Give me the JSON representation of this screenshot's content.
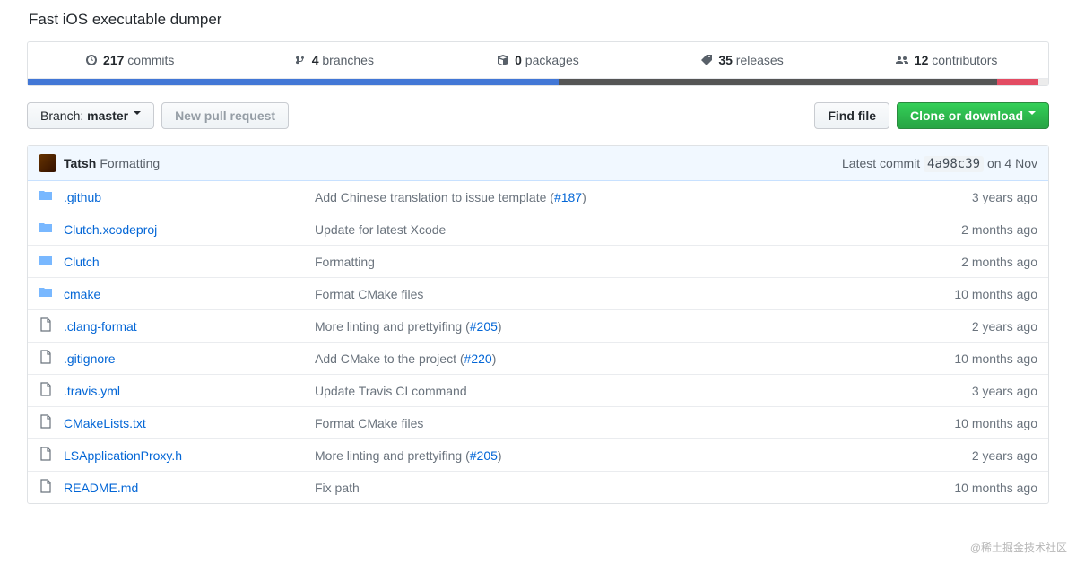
{
  "about": "Fast iOS executable dumper",
  "stats": {
    "commits": {
      "count": "217",
      "label": "commits"
    },
    "branches": {
      "count": "4",
      "label": "branches"
    },
    "packages": {
      "count": "0",
      "label": "packages"
    },
    "releases": {
      "count": "35",
      "label": "releases"
    },
    "contributors": {
      "count": "12",
      "label": "contributors"
    }
  },
  "languages": [
    {
      "color": "#4277d6",
      "pct": 52
    },
    {
      "color": "#555555",
      "pct": 43
    },
    {
      "color": "#e34c63",
      "pct": 4
    },
    {
      "color": "#ececec",
      "pct": 1
    }
  ],
  "toolbar": {
    "branch_prefix": "Branch: ",
    "branch_name": "master",
    "new_pr": "New pull request",
    "find_file": "Find file",
    "clone": "Clone or download"
  },
  "tease": {
    "author": "Tatsh",
    "msg": "Formatting",
    "latest_commit_prefix": "Latest commit ",
    "sha": "4a98c39",
    "date": " on 4 Nov"
  },
  "files": [
    {
      "type": "dir",
      "name": ".github",
      "msg": "Add Chinese translation to issue template (",
      "issue": "#187",
      "msg2": ")",
      "age": "3 years ago"
    },
    {
      "type": "dir",
      "name": "Clutch.xcodeproj",
      "msg": "Update for latest Xcode",
      "issue": "",
      "msg2": "",
      "age": "2 months ago"
    },
    {
      "type": "dir",
      "name": "Clutch",
      "msg": "Formatting",
      "issue": "",
      "msg2": "",
      "age": "2 months ago"
    },
    {
      "type": "dir",
      "name": "cmake",
      "msg": "Format CMake files",
      "issue": "",
      "msg2": "",
      "age": "10 months ago"
    },
    {
      "type": "file",
      "name": ".clang-format",
      "msg": "More linting and prettyifing (",
      "issue": "#205",
      "msg2": ")",
      "age": "2 years ago"
    },
    {
      "type": "file",
      "name": ".gitignore",
      "msg": "Add CMake to the project (",
      "issue": "#220",
      "msg2": ")",
      "age": "10 months ago"
    },
    {
      "type": "file",
      "name": ".travis.yml",
      "msg": "Update Travis CI command",
      "issue": "",
      "msg2": "",
      "age": "3 years ago"
    },
    {
      "type": "file",
      "name": "CMakeLists.txt",
      "msg": "Format CMake files",
      "issue": "",
      "msg2": "",
      "age": "10 months ago"
    },
    {
      "type": "file",
      "name": "LSApplicationProxy.h",
      "msg": "More linting and prettyifing (",
      "issue": "#205",
      "msg2": ")",
      "age": "2 years ago"
    },
    {
      "type": "file",
      "name": "README.md",
      "msg": "Fix path",
      "issue": "",
      "msg2": "",
      "age": "10 months ago"
    }
  ],
  "watermark": "@稀土掘金技术社区"
}
